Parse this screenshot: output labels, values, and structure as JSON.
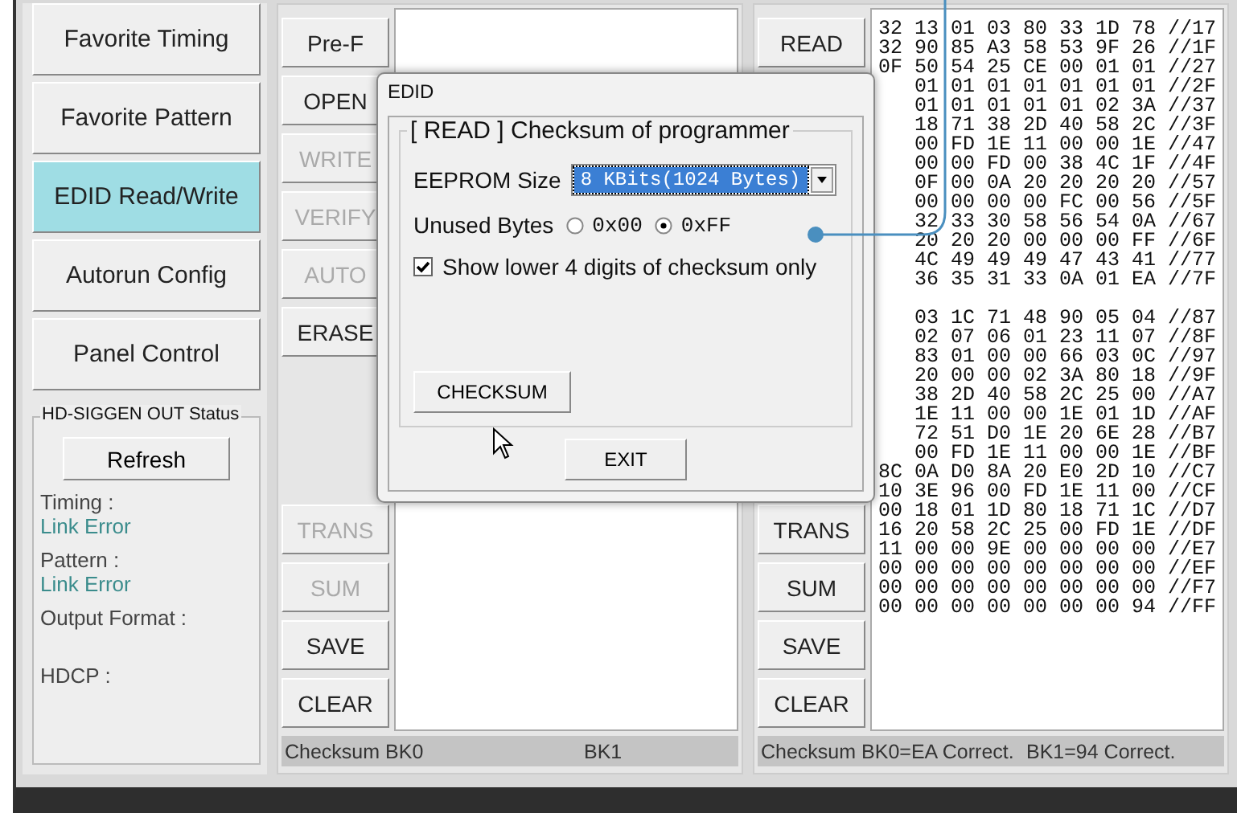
{
  "sidebar": {
    "items": [
      {
        "label": "Favorite Timing",
        "selected": false
      },
      {
        "label": "Favorite Pattern",
        "selected": false
      },
      {
        "label": "EDID Read/Write",
        "selected": true
      },
      {
        "label": "Autorun Config",
        "selected": false
      },
      {
        "label": "Panel Control",
        "selected": false
      }
    ],
    "status_group": {
      "title": "HD-SIGGEN OUT Status",
      "refresh_button": "Refresh",
      "fields": [
        {
          "label": "Timing :",
          "value": "Link Error"
        },
        {
          "label": "Pattern :",
          "value": "Link Error"
        },
        {
          "label": "Output Format :"
        },
        {
          "label": "HDCP :"
        }
      ]
    }
  },
  "left_panel": {
    "top_buttons": [
      {
        "label": "Pre-F",
        "disabled": false
      },
      {
        "label": "OPEN",
        "disabled": false
      },
      {
        "label": "WRITE",
        "disabled": true
      },
      {
        "label": "VERIFY",
        "disabled": true
      },
      {
        "label": "AUTO",
        "disabled": true
      },
      {
        "label": "ERASE",
        "disabled": false
      }
    ],
    "bottom_buttons": [
      {
        "label": "TRANS",
        "disabled": true
      },
      {
        "label": "SUM",
        "disabled": true
      },
      {
        "label": "SAVE",
        "disabled": false
      },
      {
        "label": "CLEAR",
        "disabled": false
      }
    ],
    "status_bar": [
      "Checksum BK0",
      "BK1"
    ]
  },
  "right_panel": {
    "top_buttons": [
      {
        "label": "READ",
        "disabled": false
      }
    ],
    "bottom_buttons": [
      {
        "label": "TRANS",
        "disabled": false
      },
      {
        "label": "SUM",
        "disabled": false
      },
      {
        "label": "SAVE",
        "disabled": false
      },
      {
        "label": "CLEAR",
        "disabled": false
      }
    ],
    "hex_blocks": [
      [
        "32 13 01 03 80 33 1D 78 //17",
        "32 90 85 A3 58 53 9F 26 //1F",
        "0F 50 54 25 CE 00 01 01 //27",
        "01 01 01 01 01 01 01 //2F",
        "01 01 01 01 01 02 3A //37",
        "18 71 38 2D 40 58 2C //3F",
        "00 FD 1E 11 00 00 1E //47",
        "00 00 FD 00 38 4C 1F //4F",
        "0F 00 0A 20 20 20 20 //57",
        "00 00 00 00 FC 00 56 //5F",
        "32 33 30 58 56 54 0A //67",
        "20 20 20 00 00 00 FF //6F",
        "4C 49 49 49 47 43 41 //77",
        "36 35 31 33 0A 01 EA //7F"
      ],
      [
        "03 1C 71 48 90 05 04 //87",
        "02 07 06 01 23 11 07 //8F",
        "83 01 00 00 66 03 0C //97",
        "20 00 00 02 3A 80 18 //9F",
        "38 2D 40 58 2C 25 00 //A7",
        "1E 11 00 00 1E 01 1D //AF",
        "72 51 D0 1E 20 6E 28 //B7",
        "00 FD 1E 11 00 00 1E //BF",
        "8C 0A D0 8A 20 E0 2D 10 //C7",
        "10 3E 96 00 FD 1E 11 00 //CF",
        "00 18 01 1D 80 18 71 1C //D7",
        "16 20 58 2C 25 00 FD 1E //DF",
        "11 00 00 9E 00 00 00 00 //E7",
        "00 00 00 00 00 00 00 00 //EF",
        "00 00 00 00 00 00 00 00 //F7",
        "00 00 00 00 00 00 00 94 //FF"
      ]
    ],
    "status_bar": [
      "Checksum BK0=EA Correct.",
      "BK1=94 Correct."
    ]
  },
  "dialog": {
    "title": "EDID",
    "group_title": "[ READ ] Checksum of programmer",
    "eeprom_label": "EEPROM Size",
    "eeprom_value": "8 KBits(1024 Bytes)",
    "unused_label": "Unused Bytes",
    "radios": [
      {
        "label": "0x00",
        "selected": false
      },
      {
        "label": "0xFF",
        "selected": true
      }
    ],
    "checkbox": {
      "label": "Show lower 4 digits of checksum only",
      "checked": true
    },
    "checksum_button": "CHECKSUM",
    "exit_button": "EXIT"
  }
}
